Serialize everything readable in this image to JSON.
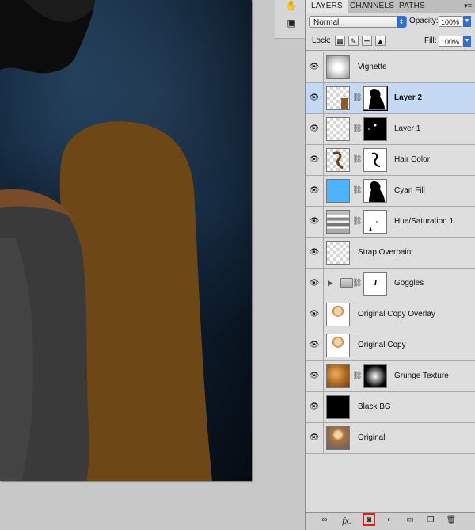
{
  "panel": {
    "tabs": [
      {
        "label": "LAYERS",
        "active": true
      },
      {
        "label": "CHANNELS",
        "active": false
      },
      {
        "label": "PATHS",
        "active": false
      }
    ],
    "menu_icon": "panel-menu-icon"
  },
  "blend": {
    "mode": "Normal",
    "opacity_label": "Opacity:",
    "opacity_value": "100%"
  },
  "lock": {
    "label": "Lock:",
    "fill_label": "Fill:",
    "fill_value": "100%",
    "buttons": [
      "lock-transparent-icon",
      "lock-image-icon",
      "lock-position-icon",
      "lock-all-icon"
    ]
  },
  "layers": [
    {
      "name": "Vignette",
      "selected": false,
      "thumb": "vignette",
      "mask": null
    },
    {
      "name": "Layer 2",
      "selected": true,
      "thumb": "layer2",
      "mask": "silhouette"
    },
    {
      "name": "Layer 1",
      "selected": false,
      "thumb": "transparent",
      "mask": "dots"
    },
    {
      "name": "Hair Color",
      "selected": false,
      "thumb": "hair",
      "mask": "hairmask"
    },
    {
      "name": "Cyan Fill",
      "selected": false,
      "thumb": "cyan",
      "mask": "silhouette"
    },
    {
      "name": "Hue/Saturation 1",
      "selected": false,
      "thumb": "huesat",
      "mask": "huesatmask"
    },
    {
      "name": "Strap Overpaint",
      "selected": false,
      "thumb": "transparent",
      "mask": null
    },
    {
      "name": "Goggles",
      "selected": false,
      "thumb": "group",
      "mask": "goggles"
    },
    {
      "name": "Original Copy Overlay",
      "selected": false,
      "thumb": "portrait",
      "mask": null
    },
    {
      "name": "Original Copy",
      "selected": false,
      "thumb": "portrait",
      "mask": null
    },
    {
      "name": "Grunge Texture",
      "selected": false,
      "thumb": "grunge",
      "mask": "radial"
    },
    {
      "name": "Black BG",
      "selected": false,
      "thumb": "black",
      "mask": null
    },
    {
      "name": "Original",
      "selected": false,
      "thumb": "portrait2",
      "mask": null
    }
  ],
  "bottom_bar": [
    "link-layers-icon",
    "fx-icon",
    "add-mask-icon",
    "adjustment-layer-icon",
    "new-group-icon",
    "new-layer-icon",
    "trash-icon"
  ],
  "bottom_labels": {
    "fx": "fx."
  },
  "colors": {
    "selected_row": "#c5d8f4",
    "highlight_border": "#e0231b",
    "cyan_fill": "#4fb2ff",
    "orange_shape": "#6b4416"
  }
}
